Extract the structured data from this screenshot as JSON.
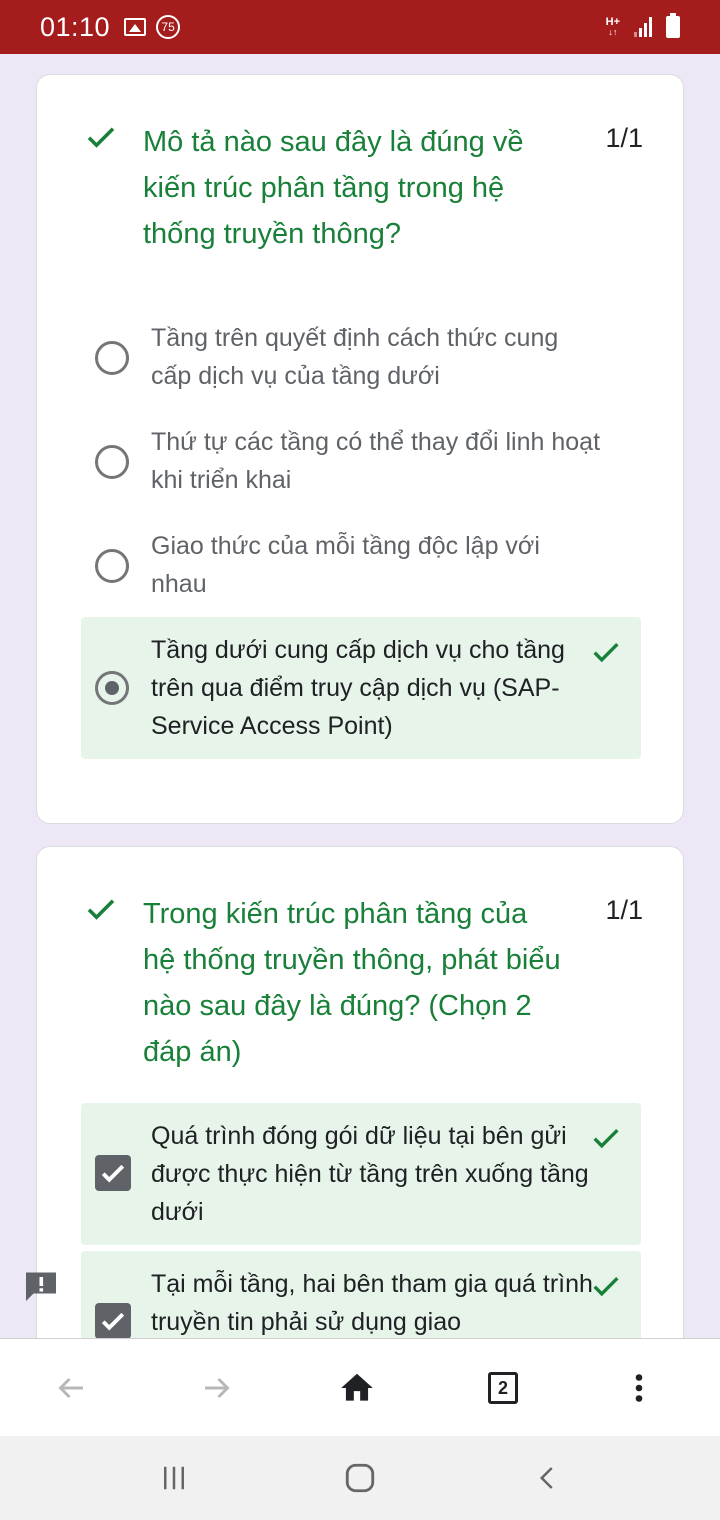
{
  "status_bar": {
    "time": "01:10",
    "notification_badge": "75",
    "network_label": "H+",
    "background_color": "#a51c1c"
  },
  "questions": [
    {
      "text": "Mô tả nào sau đây là đúng về kiến trúc phân tầng trong hệ thống truyền thông?",
      "score": "1/1",
      "options": [
        {
          "text": "Tầng trên quyết định cách thức cung cấp dịch vụ của tầng dưới"
        },
        {
          "text": "Thứ tự các tầng có thể thay đổi linh hoạt khi triển khai"
        },
        {
          "text": "Giao thức của mỗi tầng độc lập với nhau"
        },
        {
          "text": "Tầng dưới cung cấp dịch vụ cho tầng trên qua điểm truy cập dịch vụ (SAP-Service Access Point)"
        }
      ]
    },
    {
      "text": "Trong kiến trúc phân tầng của hệ thống truyền thông, phát biểu nào sau đây là đúng? (Chọn 2 đáp án)",
      "score": "1/1",
      "options": [
        {
          "text": "Quá trình đóng gói dữ liệu tại bên gửi được thực hiện từ tầng trên xuống tầng dưới"
        },
        {
          "text": "Tại mỗi tầng, hai bên tham gia quá trình truyền tin phải sử dụng giao"
        }
      ]
    }
  ],
  "browser_nav": {
    "tab_count": "2"
  },
  "colors": {
    "correct_green": "#188038",
    "correct_bg": "#e6f4ea",
    "page_bg": "#ede7f6"
  }
}
